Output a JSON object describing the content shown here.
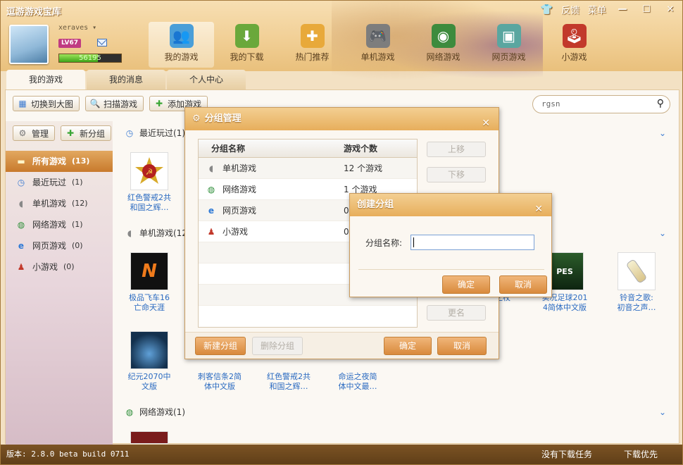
{
  "app": {
    "title": "逗游游戏宝库"
  },
  "window": {
    "feedback": "反馈",
    "menu": "菜单",
    "minimize": "—",
    "maximize": "☐",
    "close": "✕"
  },
  "user": {
    "name": "xeraves",
    "level": "LV67",
    "xp": "56195",
    "xp_fill": 0.62
  },
  "nav": [
    {
      "label": "我的游戏",
      "icon": "my-games-icon",
      "color": "#4a9ed8"
    },
    {
      "label": "我的下载",
      "icon": "download-icon",
      "color": "#6aa83b"
    },
    {
      "label": "热门推荐",
      "icon": "hot-recommend-icon",
      "color": "#e8a93a"
    },
    {
      "label": "单机游戏",
      "icon": "gamepad-icon",
      "color": "#7d7d7d"
    },
    {
      "label": "网络游戏",
      "icon": "online-game-icon",
      "color": "#3d8b3d"
    },
    {
      "label": "网页游戏",
      "icon": "web-game-icon",
      "color": "#5aa6a0"
    },
    {
      "label": "小游戏",
      "icon": "joystick-icon",
      "color": "#c2392b"
    }
  ],
  "tabs": [
    "我的游戏",
    "我的消息",
    "个人中心"
  ],
  "toolbar": {
    "switch": "切换到大图",
    "scan": "扫描游戏",
    "add": "添加游戏"
  },
  "search": {
    "value": "rgsn"
  },
  "sidebar": {
    "manage": "管理",
    "new_group": "新分组",
    "items": [
      {
        "label": "所有游戏",
        "count": "(13)",
        "icon": "folder-icon"
      },
      {
        "label": "最近玩过",
        "count": "(1)",
        "icon": "clock-icon"
      },
      {
        "label": "单机游戏",
        "count": "(12)",
        "icon": "mouse-icon"
      },
      {
        "label": "网络游戏",
        "count": "(1)",
        "icon": "globe-icon"
      },
      {
        "label": "网页游戏",
        "count": "(0)",
        "icon": "ie-icon"
      },
      {
        "label": "小游戏",
        "count": "(0)",
        "icon": "joystick-icon"
      }
    ]
  },
  "sections": {
    "recent": "最近玩过(1)",
    "single": "单机游戏(12",
    "online": "网络游戏(1)"
  },
  "games": {
    "recent_1": [
      "红色警戒2共",
      "和国之辉…"
    ],
    "single_1": [
      "极品飞车16",
      "亡命天涯"
    ],
    "single_2": [
      "",
      "之杖"
    ],
    "single_3": [
      "实况足球201",
      "4简体中文版"
    ],
    "single_4": [
      "铃音之歌:",
      "初音之声…"
    ],
    "row2_1": [
      "纪元2070中",
      "文版"
    ],
    "row2_2": [
      "刺客信条2简",
      "体中文版"
    ],
    "row2_3": [
      "红色警戒2共",
      "和国之辉…"
    ],
    "row2_4": [
      "命运之夜简",
      "体中文最…"
    ]
  },
  "group_dialog": {
    "title": "分组管理",
    "col_name": "分组名称",
    "col_count": "游戏个数",
    "rows": [
      {
        "name": "单机游戏",
        "count": "12 个游戏",
        "icon": "mouse-icon"
      },
      {
        "name": "网络游戏",
        "count": "1 个游戏",
        "icon": "globe-icon"
      },
      {
        "name": "网页游戏",
        "count": "0",
        "icon": "ie-icon"
      },
      {
        "name": "小游戏",
        "count": "0",
        "icon": "joystick-icon"
      }
    ],
    "move_up": "上移",
    "move_down": "下移",
    "rename": "更名",
    "new_group": "新建分组",
    "delete_group": "删除分组",
    "ok": "确定",
    "cancel": "取消"
  },
  "create_dialog": {
    "title": "创建分组",
    "label": "分组名称:",
    "value": "",
    "ok": "确定",
    "cancel": "取消"
  },
  "status": {
    "version": "版本: 2.8.0 beta build 0711",
    "no_task": "没有下载任务",
    "priority": "下载优先"
  }
}
